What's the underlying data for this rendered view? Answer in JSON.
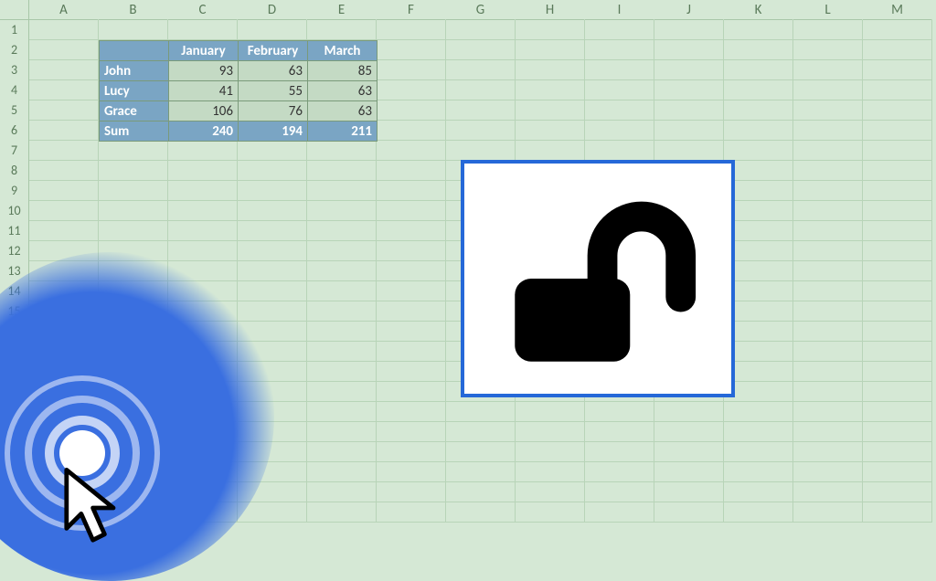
{
  "columns": [
    "A",
    "B",
    "C",
    "D",
    "E",
    "F",
    "G",
    "H",
    "I",
    "J",
    "K",
    "L",
    "M"
  ],
  "rows": [
    "1",
    "2",
    "3",
    "4",
    "5",
    "6",
    "7",
    "8",
    "9",
    "10",
    "11",
    "12",
    "13",
    "14",
    "15"
  ],
  "table": {
    "corner": "",
    "col_headers": [
      "January",
      "February",
      "March"
    ],
    "row_headers": [
      "John",
      "Lucy",
      "Grace",
      "Sum"
    ],
    "data": [
      [
        93,
        63,
        85
      ],
      [
        41,
        55,
        63
      ],
      [
        106,
        76,
        63
      ],
      [
        240,
        194,
        211
      ]
    ]
  },
  "overlay": {
    "icon_name": "unlock-icon"
  }
}
